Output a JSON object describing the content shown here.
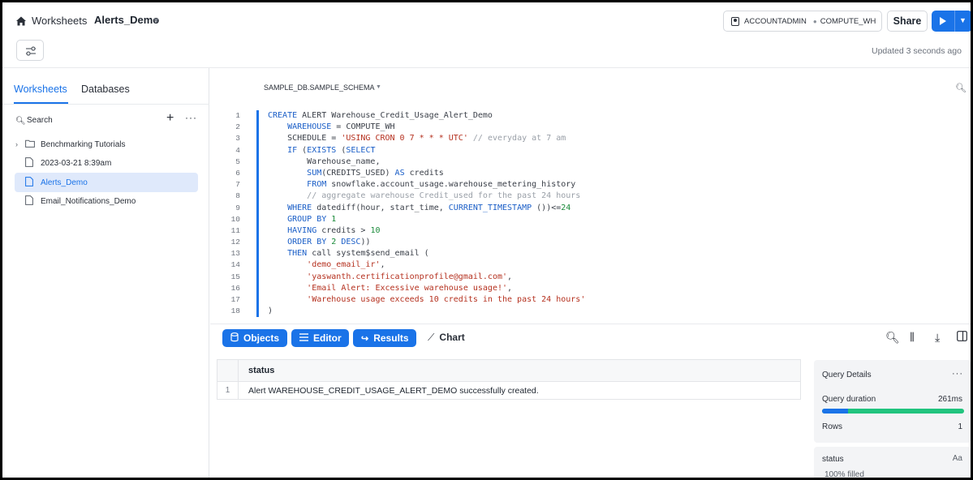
{
  "header": {
    "breadcrumb_root": "Worksheets",
    "worksheet_name": "Alerts_Demo",
    "role": "ACCOUNTADMIN",
    "warehouse": "COMPUTE_WH",
    "share_label": "Share",
    "updated_text": "Updated 3 seconds ago",
    "accent_color": "#1a73e8"
  },
  "sidebar": {
    "tabs": [
      {
        "label": "Worksheets",
        "active": true
      },
      {
        "label": "Databases",
        "active": false
      }
    ],
    "search_label": "Search",
    "items": [
      {
        "label": "Benchmarking Tutorials",
        "type": "folder",
        "icon": "folder-icon"
      },
      {
        "label": "2023-03-21 8:39am",
        "type": "file",
        "icon": "file-icon"
      },
      {
        "label": "Alerts_Demo",
        "type": "file",
        "icon": "file-icon",
        "active": true
      },
      {
        "label": "Email_Notifications_Demo",
        "type": "file",
        "icon": "file-icon"
      }
    ]
  },
  "editor": {
    "context": "SAMPLE_DB.SAMPLE_SCHEMA",
    "line_numbers": [
      "1",
      "2",
      "3",
      "4",
      "5",
      "6",
      "7",
      "8",
      "9",
      "10",
      "11",
      "12",
      "13",
      "14",
      "15",
      "16",
      "17",
      "18"
    ]
  },
  "results_toolbar": {
    "objects_label": "Objects",
    "editor_label": "Editor",
    "results_label": "Results",
    "chart_label": "Chart"
  },
  "results_table": {
    "columns": [
      "status"
    ],
    "rows": [
      {
        "index": "1",
        "status": "Alert WAREHOUSE_CREDIT_USAGE_ALERT_DEMO successfully created."
      }
    ]
  },
  "query_details": {
    "title": "Query Details",
    "duration_label": "Query duration",
    "duration_value": "261ms",
    "duration_bar_fraction": 0.18,
    "rows_label": "Rows",
    "rows_value": "1"
  },
  "column_stats": {
    "column": "status",
    "type_label": "Aa",
    "filled_text": "100% filled"
  }
}
